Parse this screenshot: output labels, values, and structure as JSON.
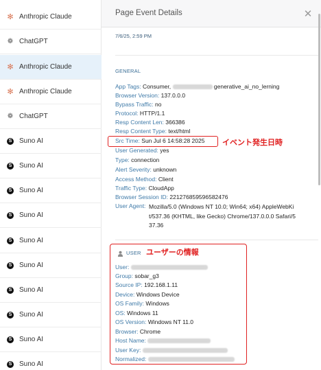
{
  "list": {
    "items": [
      {
        "label": "Anthropic Claude",
        "icon": "anthropic-icon"
      },
      {
        "label": "ChatGPT",
        "icon": "openai-icon"
      },
      {
        "label": "Anthropic Claude",
        "icon": "anthropic-icon"
      },
      {
        "label": "Anthropic Claude",
        "icon": "anthropic-icon"
      },
      {
        "label": "ChatGPT",
        "icon": "openai-icon"
      },
      {
        "label": "Suno AI",
        "icon": "suno-icon"
      },
      {
        "label": "Suno AI",
        "icon": "suno-icon"
      },
      {
        "label": "Suno AI",
        "icon": "suno-icon"
      },
      {
        "label": "Suno AI",
        "icon": "suno-icon"
      },
      {
        "label": "Suno AI",
        "icon": "suno-icon"
      },
      {
        "label": "Suno AI",
        "icon": "suno-icon"
      },
      {
        "label": "Suno AI",
        "icon": "suno-icon"
      },
      {
        "label": "Suno AI",
        "icon": "suno-icon"
      },
      {
        "label": "Suno AI",
        "icon": "suno-icon"
      },
      {
        "label": "Suno AI",
        "icon": "suno-icon"
      }
    ],
    "selected_index": 2
  },
  "panel": {
    "title": "Page Event Details",
    "close_icon": "close-icon",
    "datetime": "7/6/25, 2:59 PM"
  },
  "general": {
    "heading": "GENERAL",
    "app_tags_label": "App Tags:",
    "app_tags_prefix": "Consumer,",
    "app_tags_suffix": "generative_ai_no_lerning",
    "browser_version_label": "Browser Version:",
    "browser_version": "137.0.0.0",
    "bypass_traffic_label": "Bypass Traffic:",
    "bypass_traffic": "no",
    "protocol_label": "Protocol:",
    "protocol": "HTTP/1.1",
    "resp_content_len_label": "Resp Content Len:",
    "resp_content_len": "366386",
    "resp_content_type_label": "Resp Content Type:",
    "resp_content_type": "text/html",
    "src_time_label": "Src Time:",
    "src_time": "Sun Jul 6 14:58:28 2025",
    "user_generated_label": "User Generated:",
    "user_generated": "yes",
    "type_label": "Type:",
    "type": "connection",
    "alert_severity_label": "Alert Severity:",
    "alert_severity": "unknown",
    "access_method_label": "Access Method:",
    "access_method": "Client",
    "traffic_type_label": "Traffic Type:",
    "traffic_type": "CloudApp",
    "browser_session_id_label": "Browser Session ID:",
    "browser_session_id": "221276859596582476",
    "user_agent_label": "User Agent:",
    "user_agent_lines": [
      "Mozilla/5.0 (Windows NT 10.0; Win64; x64) AppleWebKi",
      "t/537.36 (KHTML, like Gecko) Chrome/137.0.0.0 Safari/5",
      "37.36"
    ]
  },
  "user": {
    "heading": "USER",
    "user_label": "User:",
    "group_label": "Group:",
    "group": "sobar_g3",
    "source_ip_label": "Source IP:",
    "source_ip": "192.168.1.11",
    "device_label": "Device:",
    "device": "Windows Device",
    "os_family_label": "OS Family:",
    "os_family": "Windows",
    "os_label": "OS:",
    "os": "Windows 11",
    "os_version_label": "OS Version:",
    "os_version": "Windows NT 11.0",
    "browser_label": "Browser:",
    "browser": "Chrome",
    "host_name_label": "Host Name:",
    "user_key_label": "User Key:",
    "normalized_label": "Normalized:"
  },
  "annotations": {
    "event_time": "イベント発生日時",
    "user_info": "ユーザーの情報"
  },
  "colors": {
    "label": "#3f7aa8",
    "annotation": "#e02020",
    "selected_row": "#e6f1fa",
    "anthropic": "#d97757"
  }
}
